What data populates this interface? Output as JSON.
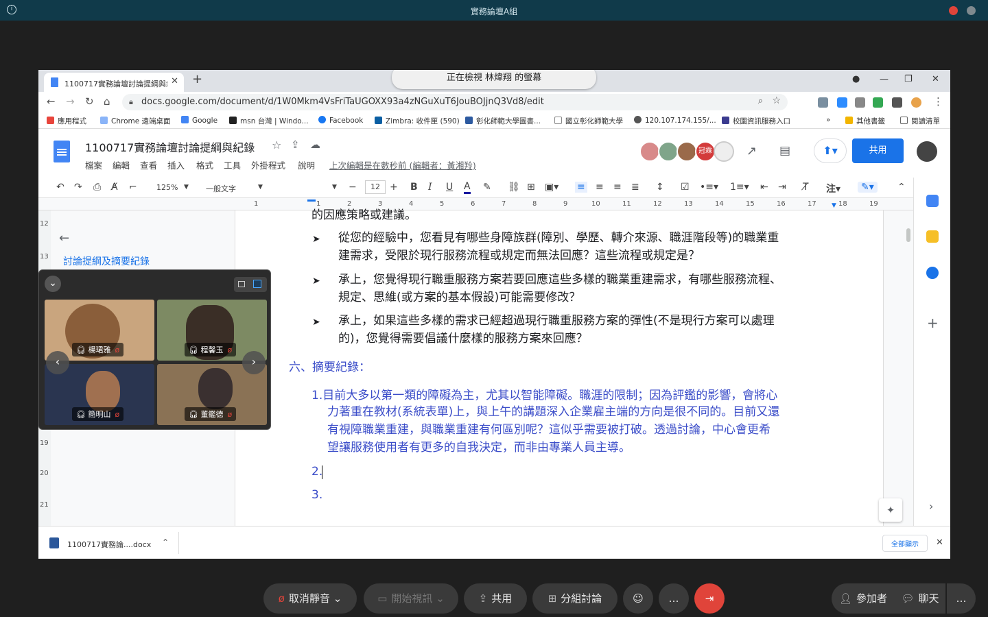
{
  "meeting": {
    "title": "實務論壇A組",
    "info_icon": "i"
  },
  "browser": {
    "tab_title": "1100717實務論壇討論提綱與紀錄",
    "tab_close": "✕",
    "new_tab": "+",
    "viewing_banner": "正在檢視 林煒翔 的螢幕",
    "url": "docs.google.com/document/d/1W0Mkm4VsFriTaUGOXX93a4zNGuXuT6JouBOJjnQ3Vd8/edit",
    "bookmarks": [
      {
        "label": "應用程式",
        "color": "#e8453c"
      },
      {
        "label": "Chrome 遠端桌面",
        "color": "#8ab4f8"
      },
      {
        "label": "Google",
        "color": "#4285f4"
      },
      {
        "label": "msn 台灣 | Windo...",
        "color": "#222222"
      },
      {
        "label": "Facebook",
        "color": "#1877f2"
      },
      {
        "label": "Zimbra: 收件匣 (590)",
        "color": "#0a5fa3"
      },
      {
        "label": "彰化師範大學圖書...",
        "color": "#2d5aa0"
      },
      {
        "label": "國立彰化師範大學",
        "color": "#888888"
      },
      {
        "label": "120.107.174.155/...",
        "color": "#555555"
      },
      {
        "label": "校園資訊服務入口",
        "color": "#3b3b8f"
      },
      {
        "label": "»",
        "color": ""
      },
      {
        "label": "其他書籤",
        "color": "#f2b500"
      },
      {
        "label": "閱讀清單",
        "color": "#666666"
      }
    ]
  },
  "docs": {
    "title": "1100717實務論壇討論提綱與紀錄",
    "menus": [
      "檔案",
      "編輯",
      "查看",
      "插入",
      "格式",
      "工具",
      "外掛程式",
      "說明"
    ],
    "last_edit": "上次編輯是在數秒前 (編輯者：黃湘羚)",
    "share_label": "共用",
    "avatar_badge": "冠霖",
    "toolbar": {
      "zoom": "125%",
      "style": "一般文字",
      "font_size": "12"
    },
    "ruler_numbers": [
      "1",
      "1",
      "2",
      "3",
      "4",
      "5",
      "6",
      "7",
      "8",
      "9",
      "10",
      "11",
      "12",
      "13",
      "14",
      "15",
      "16",
      "17",
      "18",
      "19"
    ],
    "vruler_numbers": [
      "12",
      "13",
      "19",
      "20",
      "21"
    ],
    "outline_title": "討論提綱及摘要紀錄",
    "content": {
      "line_top": "的因應策略或建議。",
      "bullets": [
        [
          "從您的經驗中，您看見有哪些身障族群(障別、學歷、轉介來源、職涯階段等)的職業重",
          "建需求，受限於現行服務流程或規定而無法回應？這些流程或規定是？"
        ],
        [
          "承上，您覺得現行職重服務方案若要回應這些多樣的職業重建需求，有哪些服務流程、",
          "規定、思維(或方案的基本假設)可能需要修改？"
        ],
        [
          "承上，如果這些多樣的需求已經超過現行職重服務方案的彈性(不是現行方案可以處理",
          "的)，您覺得需要倡議什麼樣的服務方案來回應？"
        ]
      ],
      "section_heading": "六、摘要紀錄：",
      "notes": [
        [
          "1.目前大多以第一類的障礙為主，尤其以智能障礙。職涯的限制；因為評鑑的影響，會將心",
          "力著重在教材(系統表單)上，與上午的講題深入企業雇主端的方向是很不同的。目前又還",
          "有視障職業重建，與職業重建有何區別呢？這似乎需要被打破。透過討論，中心會更希",
          "望讓服務使用者有更多的自我決定，而非由專業人員主導。"
        ],
        [
          "2."
        ],
        [
          "3."
        ]
      ]
    }
  },
  "download": {
    "file": "1100717實務論....docx",
    "show_all": "全部顯示",
    "close": "✕"
  },
  "video": {
    "participants": [
      {
        "name": "楊珺雅",
        "bg": "#c9a57e"
      },
      {
        "name": "程馨玉",
        "bg": "#7d8a63"
      },
      {
        "name": "簡明山",
        "bg": "#2a3550"
      },
      {
        "name": "董鑑德",
        "bg": "#8a7255"
      }
    ],
    "prev": "‹",
    "next": "›",
    "collapse": "⌄"
  },
  "controls": {
    "unmute": "取消靜音",
    "start_video": "開始視訊",
    "share": "共用",
    "breakout": "分組討論",
    "more": "…",
    "participants": "參加者",
    "chat": "聊天"
  },
  "colors": {
    "meeting_bar": "#103a4a",
    "docs_blue": "#1a73e8",
    "note_blue": "#3c4ec9",
    "leave_red": "#e0443a"
  }
}
